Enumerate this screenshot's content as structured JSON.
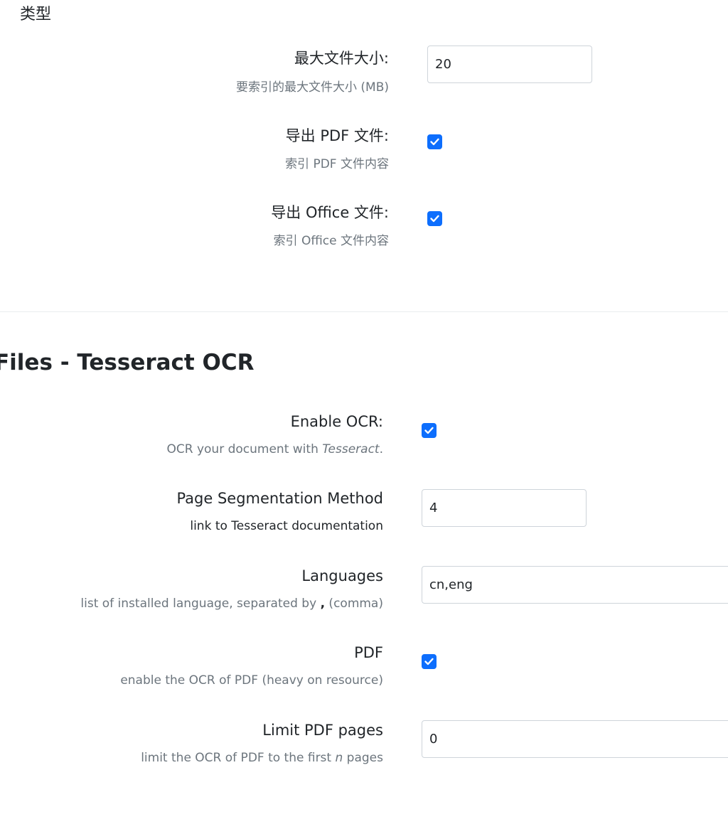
{
  "top_section": {
    "heading": "类型",
    "rows": [
      {
        "label": "最大文件大小:",
        "help": "要索引的最大文件大小 (MB)",
        "value": "20"
      },
      {
        "label": "导出 PDF 文件:",
        "help": "索引 PDF 文件内容",
        "checked": true
      },
      {
        "label": "导出 Office 文件:",
        "help": "索引 Office 文件内容",
        "checked": true
      }
    ]
  },
  "ocr_section": {
    "title": "Files - Tesseract OCR",
    "enable": {
      "label": "Enable OCR:",
      "help_prefix": "OCR your document with ",
      "help_em": "Tesseract",
      "help_suffix": ".",
      "checked": true
    },
    "psm": {
      "label": "Page Segmentation Method",
      "help": "link to Tesseract documentation",
      "value": "4"
    },
    "languages": {
      "label": "Languages",
      "help_prefix": "list of installed language, separated by ",
      "help_code": ",",
      "help_suffix": " (comma)",
      "value": "cn,eng"
    },
    "pdf": {
      "label": "PDF",
      "help": "enable the OCR of PDF (heavy on resource)",
      "checked": true
    },
    "limit": {
      "label": "Limit PDF pages",
      "help_prefix": "limit the OCR of PDF to the first ",
      "help_em": "n",
      "help_suffix": " pages",
      "value": "0"
    }
  }
}
